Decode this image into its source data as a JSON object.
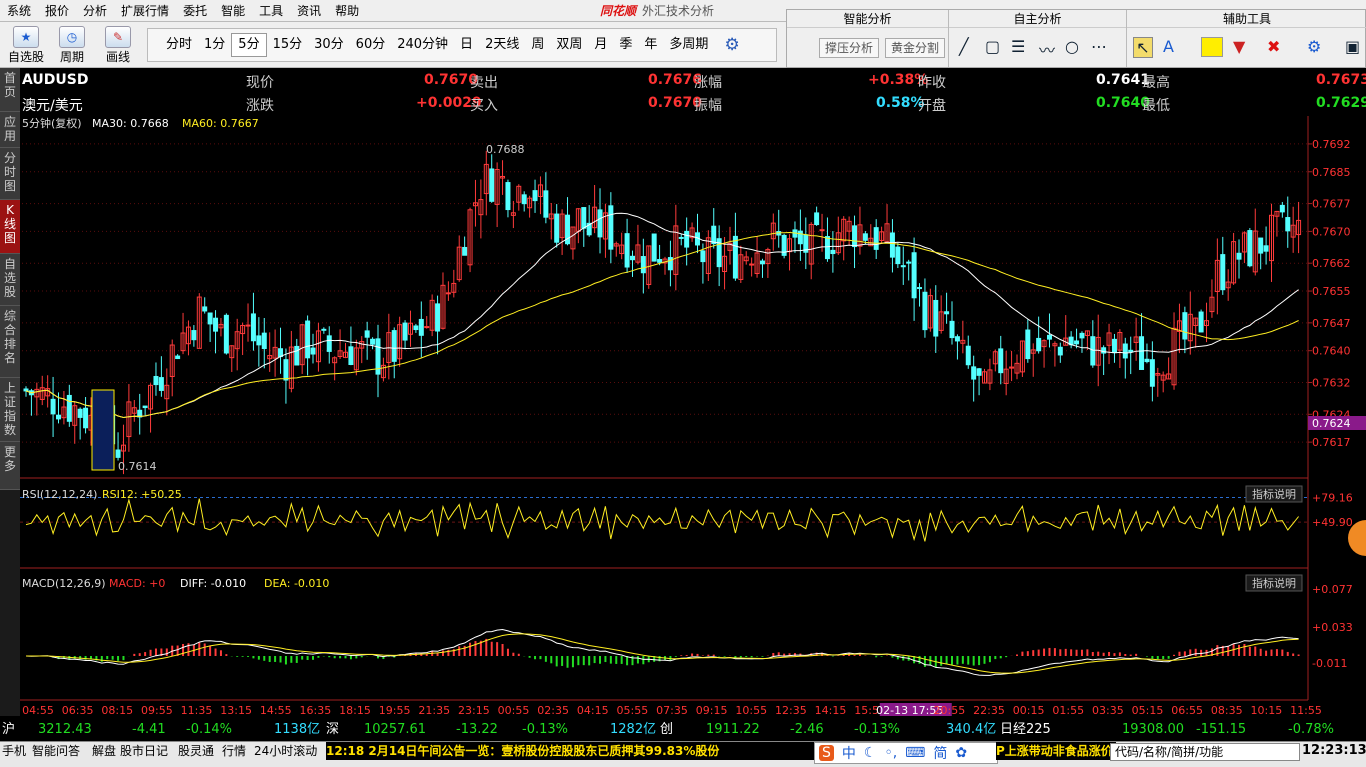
{
  "menu": [
    "系统",
    "报价",
    "分析",
    "扩展行情",
    "委托",
    "智能",
    "工具",
    "资讯",
    "帮助"
  ],
  "app_title": {
    "logo": "同花顺",
    "text": "外汇技术分析"
  },
  "toolbar": {
    "buttons": [
      "自选股",
      "周期",
      "画线"
    ],
    "periods": [
      "分时",
      "1分",
      "5分",
      "15分",
      "30分",
      "60分",
      "240分钟",
      "日",
      "2天线",
      "周",
      "双周",
      "月",
      "季",
      "年",
      "多周期"
    ],
    "active_period": "5分"
  },
  "right_panel": {
    "sections": [
      {
        "title": "智能分析",
        "buttons": [
          "撑压分析",
          "黄金分割"
        ]
      },
      {
        "title": "自主分析"
      },
      {
        "title": "辅助工具"
      }
    ]
  },
  "side_tabs": [
    "首页",
    "应用",
    "分时图",
    "K线图",
    "自选股",
    "综合排名",
    "上证指数",
    "更多"
  ],
  "active_side_tab": "K线图",
  "quote": {
    "symbol": "AUDUSD",
    "name": "澳元/美元",
    "row1": [
      {
        "label": "现价",
        "value": "0.7670"
      },
      {
        "label": "卖出",
        "value": "0.7676"
      },
      {
        "label": "涨幅",
        "value": "+0.38%"
      },
      {
        "label": "昨收",
        "value": "0.7641"
      },
      {
        "label": "最高",
        "value": "0.7673"
      }
    ],
    "row2": [
      {
        "label": "涨跌",
        "value": "+0.0029"
      },
      {
        "label": "买入",
        "value": "0.7670"
      },
      {
        "label": "振幅",
        "value": "0.58%"
      },
      {
        "label": "开盘",
        "value": "0.7640"
      },
      {
        "label": "最低",
        "value": "0.7629"
      }
    ]
  },
  "main_chart": {
    "period_label": "5分钟(复权)",
    "ma30": "MA30: 0.7668",
    "ma60": "MA60: 0.7667",
    "high_mark": "0.7688",
    "low_mark": "0.7614",
    "current_price_tag": "0.7624",
    "highlight_time": "02-13 17:55"
  },
  "rsi": {
    "label": "RSI(12,12,24)",
    "value": "RSI12: +50.25",
    "ticks": [
      "+79.16",
      "+49.90"
    ],
    "explain": "指标说明"
  },
  "macd": {
    "label": "MACD(12,26,9)",
    "macd": "MACD: +0",
    "diff": "DIFF: -0.010",
    "dea": "DEA: -0.010",
    "ticks": [
      "+0.077",
      "+0.033",
      "-0.011"
    ],
    "explain": "指标说明"
  },
  "status": {
    "sh": {
      "tag": "沪",
      "v1": "3212.43",
      "v2": "-4.41",
      "v3": "-0.14%",
      "v4": "1138亿"
    },
    "sz": {
      "tag": "深",
      "v1": "10257.61",
      "v2": "-13.22",
      "v3": "-0.13%",
      "v4": "1282亿"
    },
    "cy": {
      "tag": "创",
      "v1": "1911.22",
      "v2": "-2.46",
      "v3": "-0.13%",
      "v4": "340.4亿"
    },
    "nk": {
      "tag": "日经225",
      "v1": "19308.00",
      "v2": "-151.15",
      "v3": "-0.78%"
    }
  },
  "nav": {
    "items": [
      "手机",
      "智能问答",
      "解盘",
      "股市日记",
      "股灵通",
      "行情",
      "24小时滚动"
    ],
    "ticker": "12:18 2月14日午间公告一览：壹桥股份控股股东已质押其99.83%股份",
    "ticker2": "P上涨带动非食品涨价",
    "search_placeholder": "代码/名称/简拼/功能",
    "clock": "12:23:13"
  },
  "chart_data": {
    "type": "candlestick",
    "symbol": "AUDUSD",
    "period": "5m",
    "y_ticks": [
      0.7692,
      0.7685,
      0.7677,
      0.767,
      0.7662,
      0.7655,
      0.7647,
      0.764,
      0.7632,
      0.7624,
      0.7617
    ],
    "ylim": [
      0.7611,
      0.7695
    ],
    "x_ticks": [
      "04:55",
      "06:35",
      "08:15",
      "09:55",
      "11:35",
      "13:15",
      "14:55",
      "16:35",
      "18:15",
      "19:55",
      "21:35",
      "23:15",
      "00:55",
      "02:35",
      "04:15",
      "05:55",
      "07:35",
      "09:15",
      "10:55",
      "12:35",
      "14:15",
      "15:55",
      "02-13 17:55",
      "20:55",
      "22:35",
      "00:15",
      "01:55",
      "03:35",
      "05:15",
      "06:55",
      "08:35",
      "10:15",
      "11:55"
    ],
    "price_path": [
      [
        0,
        0.763
      ],
      [
        5,
        0.7628
      ],
      [
        10,
        0.7625
      ],
      [
        14,
        0.762
      ],
      [
        17,
        0.7616
      ],
      [
        20,
        0.7625
      ],
      [
        24,
        0.7632
      ],
      [
        28,
        0.7642
      ],
      [
        32,
        0.765
      ],
      [
        36,
        0.7644
      ],
      [
        40,
        0.7646
      ],
      [
        44,
        0.764
      ],
      [
        48,
        0.7638
      ],
      [
        52,
        0.7642
      ],
      [
        56,
        0.764
      ],
      [
        60,
        0.7641
      ],
      [
        64,
        0.7638
      ],
      [
        68,
        0.764
      ],
      [
        72,
        0.7644
      ],
      [
        75,
        0.7648
      ],
      [
        78,
        0.7655
      ],
      [
        81,
        0.767
      ],
      [
        84,
        0.7682
      ],
      [
        87,
        0.7684
      ],
      [
        90,
        0.768
      ],
      [
        93,
        0.7683
      ],
      [
        96,
        0.7674
      ],
      [
        99,
        0.7671
      ],
      [
        102,
        0.7673
      ],
      [
        104,
        0.767
      ],
      [
        106,
        0.7671
      ],
      [
        110,
        0.7668
      ],
      [
        114,
        0.7664
      ],
      [
        118,
        0.7666
      ],
      [
        122,
        0.7666
      ],
      [
        126,
        0.7663
      ],
      [
        130,
        0.7663
      ],
      [
        134,
        0.7666
      ],
      [
        138,
        0.7668
      ],
      [
        142,
        0.7666
      ],
      [
        146,
        0.7666
      ],
      [
        150,
        0.767
      ],
      [
        154,
        0.7671
      ],
      [
        158,
        0.7668
      ],
      [
        162,
        0.7661
      ],
      [
        166,
        0.7651
      ],
      [
        170,
        0.7645
      ],
      [
        174,
        0.7635
      ],
      [
        177,
        0.7629
      ],
      [
        180,
        0.7637
      ],
      [
        184,
        0.7641
      ],
      [
        188,
        0.764
      ],
      [
        192,
        0.7643
      ],
      [
        196,
        0.7641
      ],
      [
        200,
        0.764
      ],
      [
        204,
        0.764
      ],
      [
        208,
        0.7637
      ],
      [
        212,
        0.7641
      ],
      [
        216,
        0.7644
      ],
      [
        220,
        0.7659
      ],
      [
        224,
        0.7664
      ],
      [
        228,
        0.7667
      ],
      [
        232,
        0.767
      ],
      [
        235,
        0.767
      ]
    ]
  }
}
